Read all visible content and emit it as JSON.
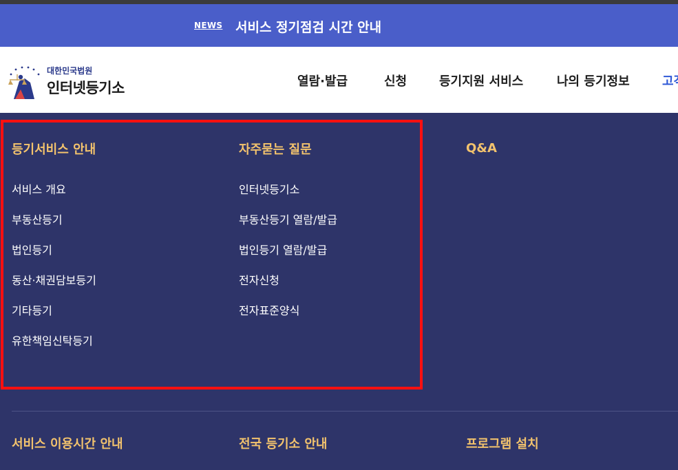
{
  "news": {
    "tag": "NEWS",
    "title": "서비스 정기점검 시간 안내"
  },
  "logo": {
    "sub": "대한민국법원",
    "main": "인터넷등기소",
    "emblem_icon": "court-emblem-icon"
  },
  "nav": {
    "items": [
      "열람·발급",
      "신청",
      "등기지원 서비스",
      "나의 등기정보",
      "고객"
    ]
  },
  "menu": {
    "columns": [
      {
        "title": "등기서비스 안내",
        "links": [
          "서비스 개요",
          "부동산등기",
          "법인등기",
          "동산·채권담보등기",
          "기타등기",
          "유한책임신탁등기"
        ]
      },
      {
        "title": "자주묻는 질문",
        "links": [
          "인터넷등기소",
          "부동산등기 열람/발급",
          "법인등기 열람/발급",
          "전자신청",
          "전자표준양식"
        ]
      },
      {
        "title": "Q&A",
        "links": []
      }
    ],
    "bottom_titles": [
      "서비스 이용시간 안내",
      "전국 등기소 안내",
      "프로그램 설치"
    ]
  },
  "colors": {
    "news_bar": "#4a5ec9",
    "menu_bg": "#2e3469",
    "title_accent": "#f3c36d",
    "highlight_border": "#ff1010",
    "nav_accent": "#2e58d6"
  }
}
